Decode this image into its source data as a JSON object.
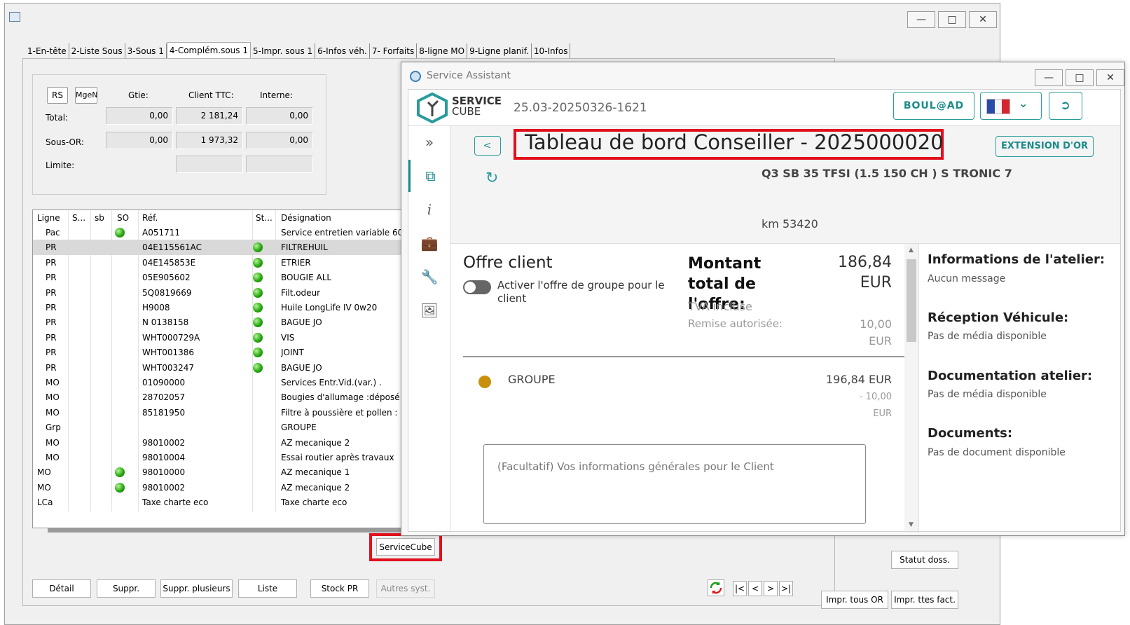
{
  "main_window": {
    "tabs": [
      "1-En-tête",
      "2-Liste Sous",
      "3-Sous 1",
      "4-Complém.sous 1",
      "5-Impr. sous 1",
      "6-Infos véh.",
      "7- Forfaits",
      "8-ligne MO",
      "9-Ligne planif.",
      "10-Infos"
    ],
    "totals": {
      "rs_button": "RS",
      "mgen_button": "MgeN",
      "col_gtie": "Gtie:",
      "col_client": "Client TTC:",
      "col_interne": "Interne:",
      "row_total": "Total:",
      "row_sous_or": "Sous-OR:",
      "row_limite": "Limite:",
      "total_gtie": "0,00",
      "total_client": "2 181,24",
      "total_interne": "0,00",
      "sous_gtie": "0,00",
      "sous_client": "1 973,32",
      "sous_interne": "0,00"
    },
    "grid_headers": [
      "Ligne",
      "S...",
      "sb",
      "SO",
      "Réf.",
      "St...",
      "Désignation"
    ],
    "grid_rows": [
      {
        "ligne": "Pac",
        "so": true,
        "ref": "A051711",
        "st": false,
        "des": "Service entretien variable 60"
      },
      {
        "ligne": "PR",
        "so": false,
        "ref": "04E115561AC",
        "st": true,
        "des": "FILTREHUIL",
        "selected": true
      },
      {
        "ligne": "PR",
        "so": false,
        "ref": "04E145853E",
        "st": true,
        "des": "ETRIER"
      },
      {
        "ligne": "PR",
        "so": false,
        "ref": "05E905602",
        "st": true,
        "des": "BOUGIE ALL"
      },
      {
        "ligne": "PR",
        "so": false,
        "ref": "5Q0819669",
        "st": true,
        "des": "Filt.odeur"
      },
      {
        "ligne": "PR",
        "so": false,
        "ref": "H9008",
        "st": true,
        "des": "Huile LongLife IV 0w20"
      },
      {
        "ligne": "PR",
        "so": false,
        "ref": "N  0138158",
        "st": true,
        "des": "BAGUE JO"
      },
      {
        "ligne": "PR",
        "so": false,
        "ref": "WHT000729A",
        "st": true,
        "des": "VIS"
      },
      {
        "ligne": "PR",
        "so": false,
        "ref": "WHT001386",
        "st": true,
        "des": "JOINT"
      },
      {
        "ligne": "PR",
        "so": false,
        "ref": "WHT003247",
        "st": true,
        "des": "BAGUE JO"
      },
      {
        "ligne": "MO",
        "so": false,
        "ref": "01090000",
        "st": false,
        "des": "Services Entr.Vid.(var.) ."
      },
      {
        "ligne": "MO",
        "so": false,
        "ref": "28702057",
        "st": false,
        "des": "Bougies d'allumage :déposé"
      },
      {
        "ligne": "MO",
        "so": false,
        "ref": "85181950",
        "st": false,
        "des": "Filtre à poussière et pollen :"
      },
      {
        "ligne": "Grp",
        "so": false,
        "ref": "",
        "st": false,
        "des": "GROUPE"
      },
      {
        "ligne": "MO",
        "so": false,
        "ref": "98010002",
        "st": false,
        "des": "AZ mecanique 2"
      },
      {
        "ligne": "MO",
        "so": false,
        "ref": "98010004",
        "st": false,
        "des": "Essai routier après travaux"
      },
      {
        "ligne": "MO",
        "so": true,
        "ref": "98010000",
        "st": false,
        "des": "AZ mecanique 1",
        "top": true
      },
      {
        "ligne": "MO",
        "so": true,
        "ref": "98010002",
        "st": false,
        "des": "AZ mecanique 2",
        "top": true
      },
      {
        "ligne": "LCa",
        "so": false,
        "ref": "Taxe charte eco",
        "st": false,
        "des": "Taxe charte eco",
        "top": true
      }
    ],
    "buttons": {
      "servicecube": "ServiceCube",
      "detail": "Détail",
      "suppr": "Suppr.",
      "suppr_plusieurs": "Suppr. plusieurs",
      "liste": "Liste",
      "stock_pr": "Stock PR",
      "autres_syst": "Autres syst.",
      "statut_doss": "Statut doss.",
      "impr_tous_or": "Impr. tous OR",
      "impr_ttes_fact": "Impr. ttes fact."
    },
    "nav": [
      "|<",
      "<",
      ">",
      ">|"
    ]
  },
  "service_assistant": {
    "title": "Service Assistant",
    "logo_line1": "SERVICE",
    "logo_line2": "CUBE",
    "order_ref": "25.03-20250326-1621",
    "boulad": "BOUL@AD",
    "page_title": "Tableau de bord Conseiller - 2025000020",
    "back": "<",
    "extension": "EXTENSION D'OR",
    "vehicle": "Q3 SB 35 TFSI (1.5 150 CH ) S TRONIC 7",
    "km": "km 53420",
    "offre": {
      "title": "Offre client",
      "toggle_label": "Activer l'offre de groupe pour le client",
      "montant_label": "Montant total de l'offre:",
      "montant_value": "186,84",
      "montant_currency": "EUR",
      "tva": "TVA incluse",
      "remise_label": "Remise autorisée:",
      "remise_value": "10,00",
      "remise_currency": "EUR",
      "group_name": "GROUPE",
      "group_amount": "196,84 EUR",
      "group_discount": "- 10,00",
      "group_discount_currency": "EUR",
      "textarea_placeholder": "(Facultatif) Vos informations générales pour le Client"
    },
    "info": {
      "atelier_h": "Informations de l'atelier:",
      "atelier_t": "Aucun message",
      "reception_h": "Réception Véhicule:",
      "reception_t": "Pas de média disponible",
      "doc_atelier_h": "Documentation atelier:",
      "doc_atelier_t": "Pas de média disponible",
      "documents_h": "Documents:",
      "documents_t": "Pas de document disponible"
    },
    "colors": {
      "teal": "#1c8a8a",
      "group_dot": "#c8900c",
      "highlight": "#e0101e"
    }
  }
}
